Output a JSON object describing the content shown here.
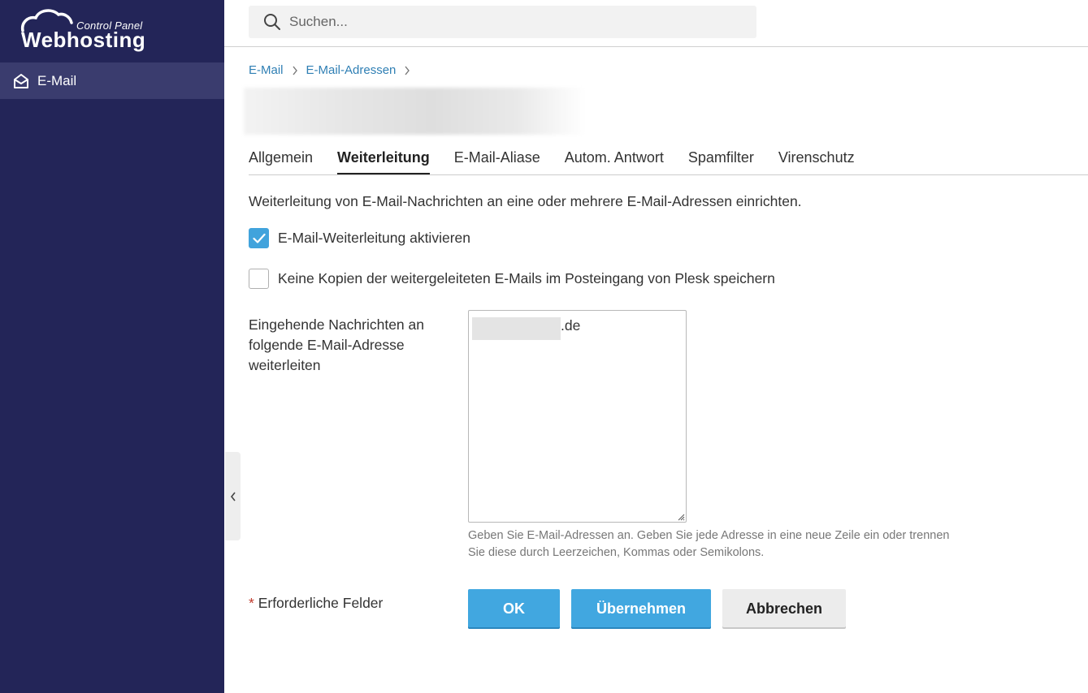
{
  "app": {
    "logo_top": "Control Panel",
    "logo_main": "Webhosting"
  },
  "sidebar": {
    "items": [
      {
        "label": "E-Mail",
        "icon": "envelope-open-icon",
        "active": true
      }
    ]
  },
  "search": {
    "placeholder": "Suchen..."
  },
  "breadcrumb": [
    {
      "label": "E-Mail"
    },
    {
      "label": "E-Mail-Adressen"
    }
  ],
  "tabs": [
    {
      "label": "Allgemein",
      "active": false
    },
    {
      "label": "Weiterleitung",
      "active": true
    },
    {
      "label": "E-Mail-Aliase",
      "active": false
    },
    {
      "label": "Autom. Antwort",
      "active": false
    },
    {
      "label": "Spamfilter",
      "active": false
    },
    {
      "label": "Virenschutz",
      "active": false
    }
  ],
  "form": {
    "description": "Weiterleitung von E-Mail-Nachrichten an eine oder mehrere E-Mail-Adressen einrichten.",
    "enable_forwarding": {
      "label": "E-Mail-Weiterleitung aktivieren",
      "checked": true
    },
    "no_copies": {
      "label": "Keine Kopien der weitergeleiteten E-Mails im Posteingang von Plesk speichern",
      "checked": false
    },
    "forward_to": {
      "label": "Eingehende Nachrichten an folgende E-Mail-Adresse weiterleiten",
      "value_visible_suffix": ".de",
      "hint": "Geben Sie E-Mail-Adressen an. Geben Sie jede Adresse in eine neue Zeile ein oder trennen Sie diese durch Leerzeichen, Kommas oder Semikolons."
    },
    "required_star": "*",
    "required_text": "Erforderliche Felder",
    "buttons": {
      "ok": "OK",
      "apply": "Übernehmen",
      "cancel": "Abbrechen"
    }
  },
  "colors": {
    "sidebar_bg": "#232558",
    "sidebar_active": "#3a3c6e",
    "accent": "#41a3dc",
    "link": "#2f7fb4"
  }
}
